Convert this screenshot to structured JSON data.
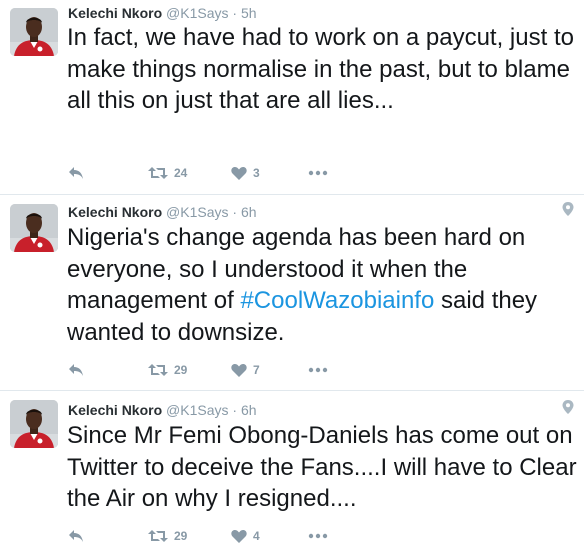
{
  "colors": {
    "text": "#14171a",
    "muted": "#8899a6",
    "hashtag": "#1b95e0",
    "divider": "#e1e8ed"
  },
  "tweets": [
    {
      "name": "Kelechi Nkoro",
      "handle": "@K1Says",
      "separator": "·",
      "time": "5h",
      "text": "In fact, we have had to work on a paycut, just to make things normalise in the past, but to blame all this on just that are all lies...",
      "retweets": "24",
      "likes": "3"
    },
    {
      "name": "Kelechi Nkoro",
      "handle": "@K1Says",
      "separator": "·",
      "time": "6h",
      "text_before": "Nigeria's change agenda has been hard on everyone, so I understood it when the management of ",
      "hashtag": "#CoolWazobiainfo",
      "text_after": " said they wanted to downsize.",
      "retweets": "29",
      "likes": "7"
    },
    {
      "name": "Kelechi Nkoro",
      "handle": "@K1Says",
      "separator": "·",
      "time": "6h",
      "text": "Since Mr Femi Obong-Daniels has come out on Twitter to deceive the Fans....I will have to Clear the Air on why I resigned....",
      "retweets": "29",
      "likes": "4"
    }
  ],
  "icons": {
    "reply": "reply-icon",
    "retweet": "retweet-icon",
    "like": "heart-icon",
    "more": "more-icon",
    "location": "location-pin-icon"
  }
}
